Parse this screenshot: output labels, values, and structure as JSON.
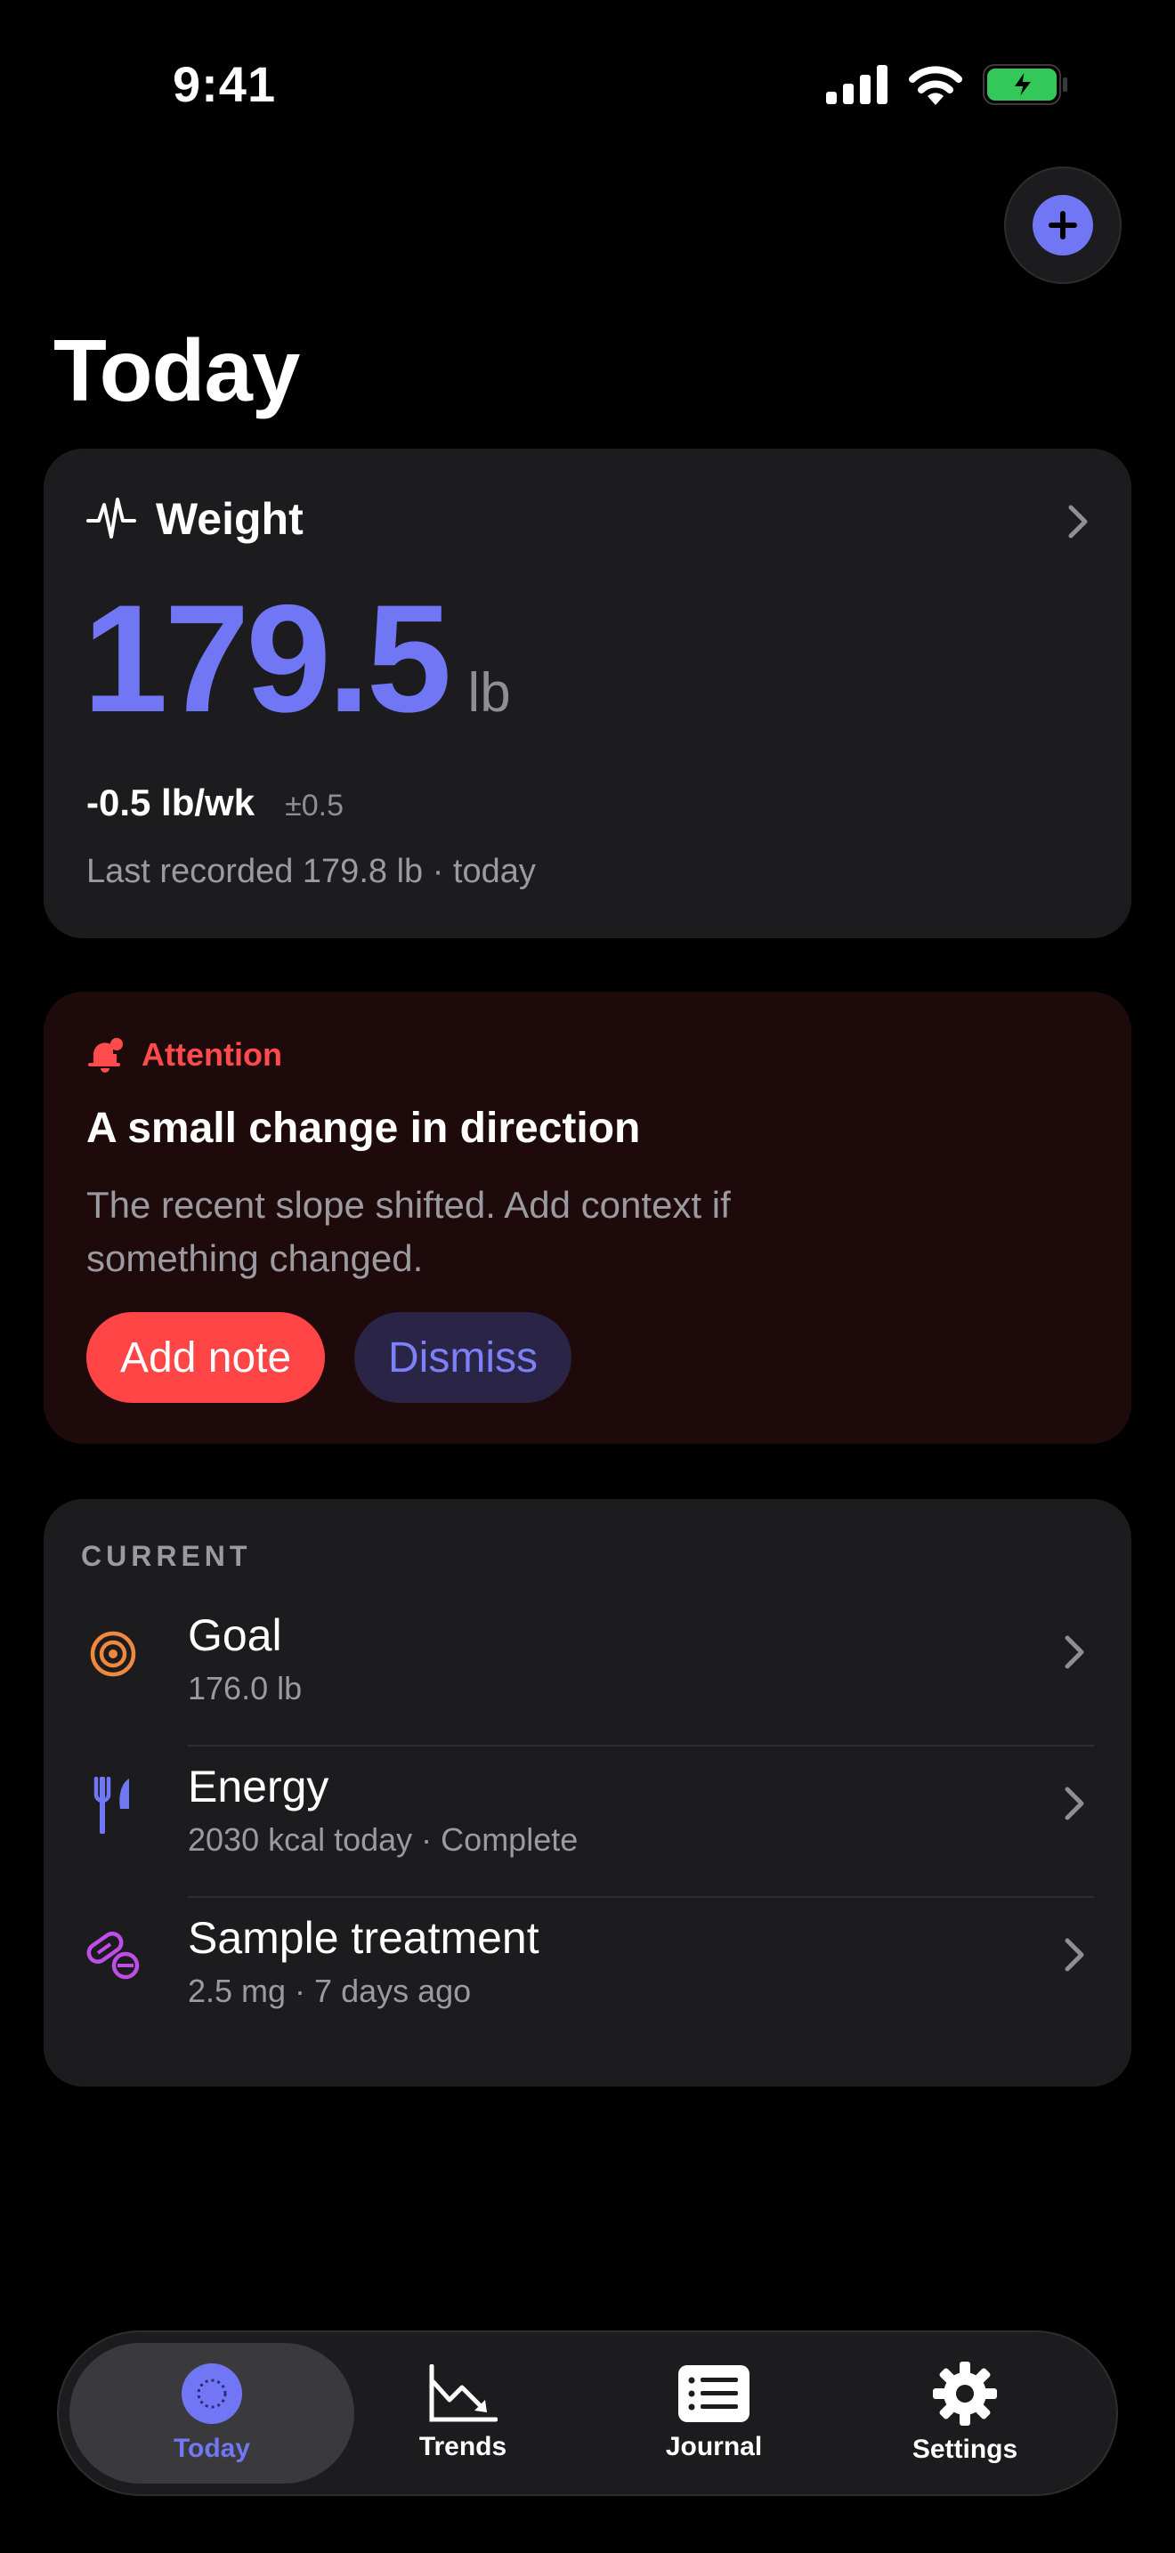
{
  "status_bar": {
    "time": "9:41"
  },
  "header": {
    "title": "Today",
    "add_icon": "plus-circle-icon"
  },
  "weight_card": {
    "label": "Weight",
    "icon": "waveform-icon",
    "value": "179.5",
    "unit": "lb",
    "rate": "-0.5 lb/wk",
    "uncertainty": "±0.5",
    "last_recorded": "Last recorded 179.8 lb · today"
  },
  "attention": {
    "label": "Attention",
    "icon": "bell-badge-icon",
    "title": "A small change in direction",
    "description": "The recent slope shifted. Add context if something changed.",
    "primary_button": "Add note",
    "secondary_button": "Dismiss"
  },
  "current": {
    "header": "CURRENT",
    "items": [
      {
        "title": "Goal",
        "subtitle": "176.0 lb",
        "icon": "target-icon",
        "color": "#f0883e"
      },
      {
        "title": "Energy",
        "subtitle": "2030 kcal today · Complete",
        "icon": "fork-knife-icon",
        "color": "#7176f4"
      },
      {
        "title": "Sample treatment",
        "subtitle": "2.5 mg · 7 days ago",
        "icon": "pill-icon",
        "color": "#bf4ee8"
      }
    ]
  },
  "tabs": [
    {
      "label": "Today",
      "icon": "today-icon",
      "active": true
    },
    {
      "label": "Trends",
      "icon": "chart-icon",
      "active": false
    },
    {
      "label": "Journal",
      "icon": "journal-icon",
      "active": false
    },
    {
      "label": "Settings",
      "icon": "gear-icon",
      "active": false
    }
  ],
  "colors": {
    "accent": "#7176f4",
    "alert": "#ff4545",
    "background": "#000000",
    "card": "#1c1c1e"
  }
}
